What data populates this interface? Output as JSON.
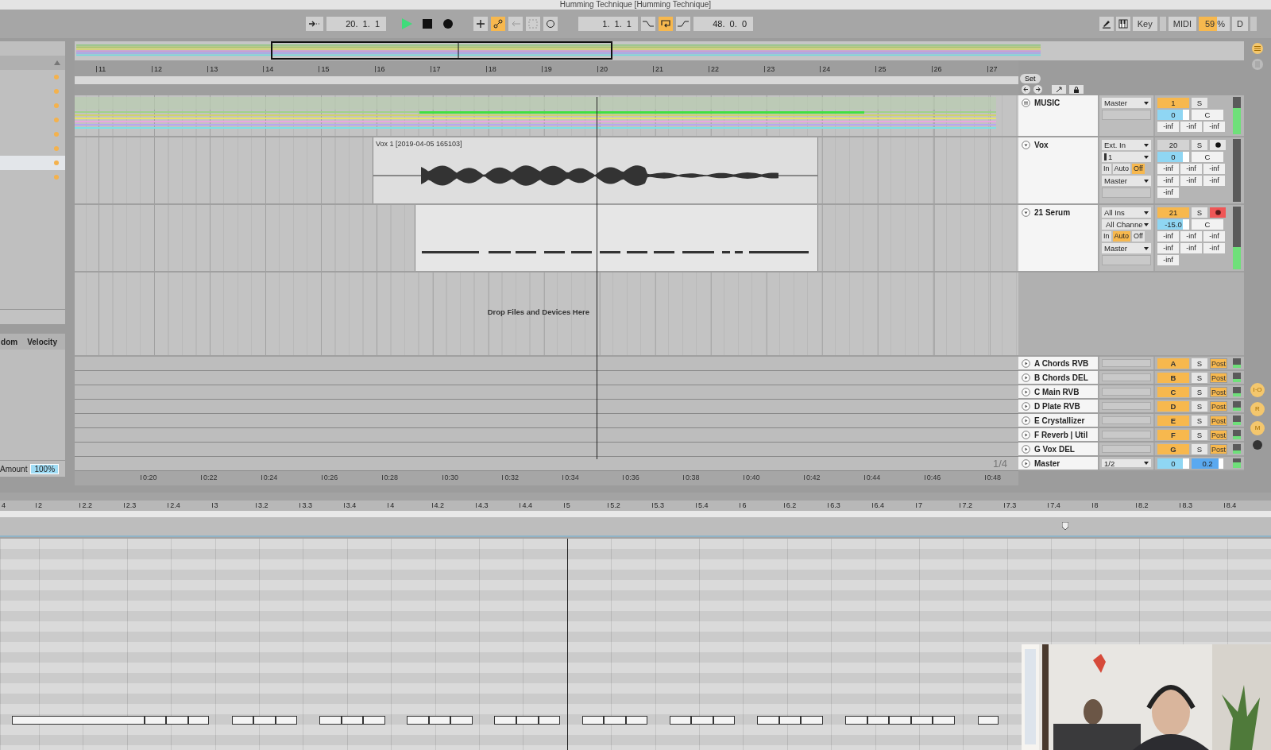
{
  "window": {
    "title": "Humming Technique  [Humming Technique]"
  },
  "transport": {
    "position": "20.  1.  1",
    "loop_start": "1.  1.  1",
    "loop_length": "48.  0.  0",
    "automation_arm": true,
    "loop": true,
    "key": "Key",
    "midi": "MIDI",
    "cpu": "59 %",
    "d": "D"
  },
  "browser": {
    "items": [
      {
        "selected": false
      },
      {
        "selected": false
      },
      {
        "selected": false
      },
      {
        "selected": false
      },
      {
        "selected": false
      },
      {
        "selected": false
      },
      {
        "selected": true
      },
      {
        "selected": false
      }
    ]
  },
  "groove": {
    "columns": [
      "dom",
      "Velocity"
    ],
    "amount_label": "Amount",
    "amount": "100%"
  },
  "arrangement": {
    "bars": [
      "11",
      "12",
      "13",
      "14",
      "15",
      "16",
      "17",
      "18",
      "19",
      "20",
      "21",
      "22",
      "23",
      "24",
      "25",
      "26",
      "27"
    ],
    "set": "Set",
    "tracks": [
      {
        "name": "MUSIC",
        "kind": "group",
        "output": "Master",
        "number": "1",
        "number_active": true,
        "solo": "S",
        "volume": "0",
        "pan": "C",
        "sends": [
          "-inf",
          "-inf",
          "-inf"
        ]
      },
      {
        "name": "Vox",
        "kind": "audio",
        "input": "Ext. In",
        "channel": "1",
        "monitor": [
          {
            "label": "In",
            "selected": false
          },
          {
            "label": "Auto",
            "selected": false
          },
          {
            "label": "Off",
            "selected": true
          }
        ],
        "output": "Master",
        "number": "20",
        "number_active": false,
        "solo": "S",
        "armed": false,
        "volume": "0",
        "pan": "C",
        "sends": [
          "-inf",
          "-inf",
          "-inf",
          "-inf",
          "-inf",
          "-inf",
          "-inf"
        ],
        "clip": {
          "kind": "audio",
          "name": "Vox 1 [2019-04-05 165103]"
        }
      },
      {
        "name": "21 Serum",
        "kind": "midi",
        "input": "All Ins",
        "channel": "All Channe",
        "monitor": [
          {
            "label": "In",
            "selected": false
          },
          {
            "label": "Auto",
            "selected": true
          },
          {
            "label": "Off",
            "selected": false
          }
        ],
        "output": "Master",
        "number": "21",
        "number_active": true,
        "solo": "S",
        "armed": true,
        "volume": "-15.0",
        "pan": "C",
        "sends": [
          "-inf",
          "-inf",
          "-inf",
          "-inf",
          "-inf",
          "-inf",
          "-inf"
        ],
        "clip": {
          "kind": "midi"
        }
      }
    ],
    "drop_hint": "Drop Files and Devices Here",
    "zoom": "1/4",
    "time_labels": [
      "0:20",
      "0:22",
      "0:24",
      "0:26",
      "0:28",
      "0:30",
      "0:32",
      "0:34",
      "0:36",
      "0:38",
      "0:40",
      "0:42",
      "0:44",
      "0:46",
      "0:48"
    ]
  },
  "returns": [
    {
      "name": "A Chords RVB",
      "letter": "A",
      "solo": "S",
      "mode": "Post"
    },
    {
      "name": "B Chords DEL",
      "letter": "B",
      "solo": "S",
      "mode": "Post"
    },
    {
      "name": "C Main RVB",
      "letter": "C",
      "solo": "S",
      "mode": "Post"
    },
    {
      "name": "D Plate RVB",
      "letter": "D",
      "solo": "S",
      "mode": "Post"
    },
    {
      "name": "E Crystallizer",
      "letter": "E",
      "solo": "S",
      "mode": "Post"
    },
    {
      "name": "F Reverb | Util",
      "letter": "F",
      "solo": "S",
      "mode": "Post"
    },
    {
      "name": "G Vox DEL",
      "letter": "G",
      "solo": "S",
      "mode": "Post"
    }
  ],
  "master": {
    "name": "Master",
    "output": "1/2",
    "volume": "0",
    "pan": "0.2"
  },
  "side_buttons": [
    "I·O",
    "R",
    "M"
  ],
  "piano_roll": {
    "ruler": [
      "4",
      "2",
      "2.2",
      "2.3",
      "2.4",
      "3",
      "3.2",
      "3.3",
      "3.4",
      "4",
      "4.2",
      "4.3",
      "4.4",
      "5",
      "5.2",
      "5.3",
      "5.4",
      "6",
      "6.2",
      "6.3",
      "6.4",
      "7",
      "7.2",
      "7.3",
      "7.4",
      "8",
      "8.2",
      "8.3",
      "8.4"
    ]
  }
}
